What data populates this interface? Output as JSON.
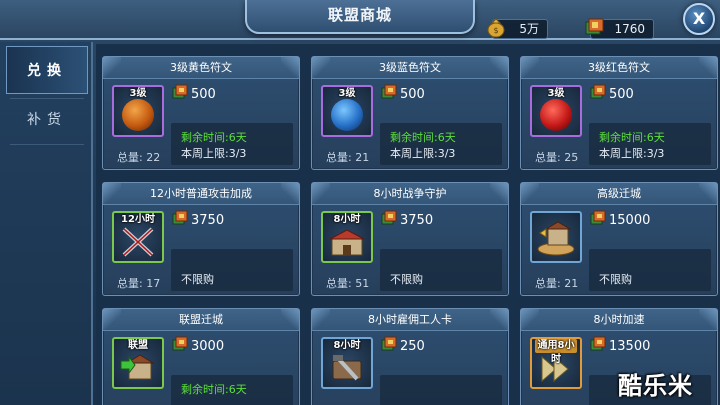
{
  "window": {
    "title": "联盟商城",
    "close_label": "X"
  },
  "currency": [
    {
      "icon": "money-bag-icon",
      "value": "5万"
    },
    {
      "icon": "alliance-token-icon",
      "value": "1760"
    }
  ],
  "tabs": [
    {
      "label": "兑换",
      "active": true
    },
    {
      "label": "补货",
      "active": false
    }
  ],
  "items": [
    {
      "title": "3级黄色符文",
      "item_label": "3级",
      "price": "500",
      "total": "总量: 22",
      "remaining": "剩余时间:6天",
      "limit": "本周上限:3/3",
      "icon": "yellow-rune-icon"
    },
    {
      "title": "3级蓝色符文",
      "item_label": "3级",
      "price": "500",
      "total": "总量: 21",
      "remaining": "剩余时间:6天",
      "limit": "本周上限:3/3",
      "icon": "blue-rune-icon"
    },
    {
      "title": "3级红色符文",
      "item_label": "3级",
      "price": "500",
      "total": "总量: 25",
      "remaining": "剩余时间:6天",
      "limit": "本周上限:3/3",
      "icon": "red-rune-icon"
    },
    {
      "title": "12小时普通攻击加成",
      "item_label": "12小时",
      "price": "3750",
      "total": "总量: 17",
      "limit": "不限购",
      "icon": "crossed-swords-icon"
    },
    {
      "title": "8小时战争守护",
      "item_label": "8小时",
      "price": "3750",
      "total": "总量: 51",
      "limit": "不限购",
      "icon": "fortress-shield-icon"
    },
    {
      "title": "高级迁城",
      "price": "15000",
      "total": "总量: 21",
      "limit": "不限购",
      "icon": "relocate-city-icon"
    },
    {
      "title": "联盟迁城",
      "item_label": "联盟",
      "price": "3000",
      "remaining": "剩余时间:6天",
      "icon": "alliance-relocate-icon"
    },
    {
      "title": "8小时雇佣工人卡",
      "item_label": "8小时",
      "price": "250",
      "icon": "worker-card-icon"
    },
    {
      "title": "8小时加速",
      "item_label": "通用8小时",
      "price": "13500",
      "icon": "speedup-icon"
    }
  ],
  "watermark": "酷乐米",
  "colors": {
    "remaining_time": "#5ee03c",
    "panel": "#2e4f72",
    "accent_border": "#9ec1e2"
  }
}
